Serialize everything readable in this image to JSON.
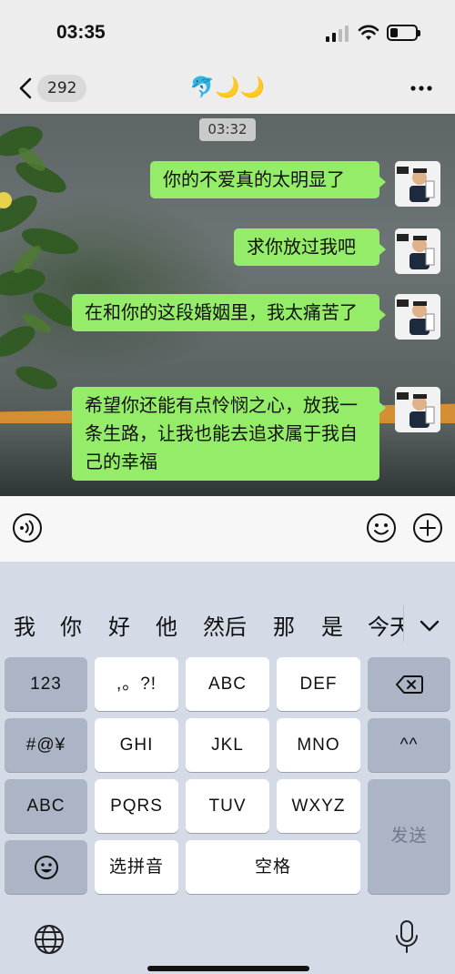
{
  "status_bar": {
    "time": "03:35",
    "icons": [
      "signal-icon",
      "wifi-icon",
      "battery-icon"
    ]
  },
  "nav": {
    "unread_count": "292",
    "title": "🐬🌙🌙"
  },
  "chat": {
    "timestamp": "03:32",
    "messages": [
      {
        "text": "你的不爱真的太明显了",
        "sender": "self"
      },
      {
        "text": "求你放过我吧",
        "sender": "self"
      },
      {
        "text": "在和你的这段婚姻里，我太痛苦了",
        "sender": "self"
      },
      {
        "text": "希望你还能有点怜悯之心，放我一条生路，让我也能去追求属于我自己的幸福",
        "sender": "self"
      }
    ]
  },
  "input_bar": {
    "icons": [
      "voice-icon",
      "emoji-icon",
      "plus-icon"
    ]
  },
  "keyboard": {
    "candidates": [
      "我",
      "你",
      "好",
      "他",
      "然后",
      "那",
      "是",
      "今天"
    ],
    "keys": {
      "num": "123",
      "punct": ",。?!",
      "abc": "ABC",
      "def": "DEF",
      "symbols": "#@¥",
      "ghi": "GHI",
      "jkl": "JKL",
      "mno": "MNO",
      "face": "^^",
      "abc_switch": "ABC",
      "pqrs": "PQRS",
      "tuv": "TUV",
      "wxyz": "WXYZ",
      "pinyin": "选拼音",
      "space": "空格",
      "send": "发送"
    }
  },
  "colors": {
    "bubble": "#95ec69",
    "keyboard_bg": "#d4dbe7",
    "accent_orange": "#e2932f"
  }
}
